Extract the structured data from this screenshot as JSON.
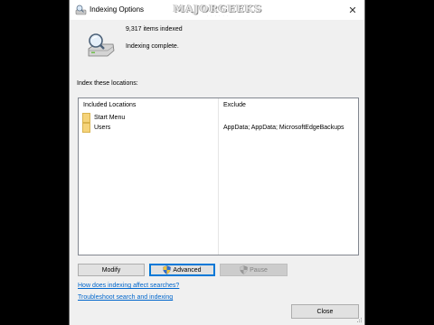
{
  "window": {
    "title": "Indexing Options",
    "watermark": {
      "text": "MAJORGEEKS",
      "sub": "· · · · · ·"
    },
    "close_glyph": "✕"
  },
  "status": {
    "icon": "drive-search-icon",
    "count": "9,317 items indexed",
    "message": "Indexing complete."
  },
  "locations": {
    "label": "Index these locations:",
    "columns": {
      "included": "Included Locations",
      "exclude": "Exclude"
    },
    "rows": [
      {
        "name": "Start Menu",
        "exclude": ""
      },
      {
        "name": "Users",
        "exclude": "AppData; AppData; MicrosoftEdgeBackups"
      }
    ]
  },
  "buttons": {
    "modify": "Modify",
    "advanced": "Advanced",
    "pause": "Pause",
    "close": "Close"
  },
  "links": {
    "how": "How does indexing affect searches?",
    "troubleshoot": "Troubleshoot search and indexing"
  },
  "colors": {
    "link": "#0066cc",
    "folder": "#f5d37a",
    "focus": "#0078d7"
  }
}
